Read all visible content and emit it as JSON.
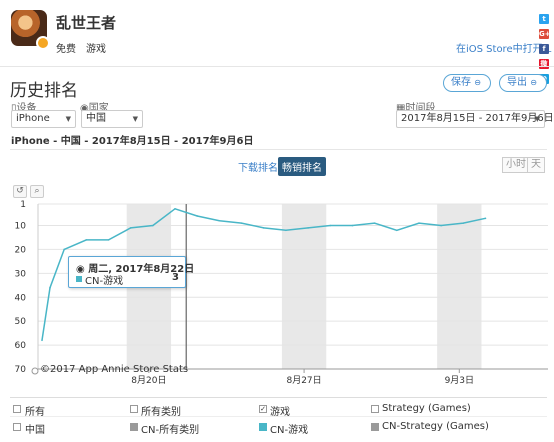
{
  "app": {
    "name": "乱世王者",
    "price": "免费",
    "category": "游戏",
    "store_link": "在iOS Store中打开 L"
  },
  "social": {
    "twitter": "t",
    "google": "G+",
    "facebook": "f",
    "weibo": "微",
    "qq": "Q"
  },
  "page": {
    "title": "历史排名",
    "save_label": "保存",
    "export_label": "导出",
    "lock_glyph": "🔒"
  },
  "filters": {
    "device_label": "设备",
    "device_value": "iPhone",
    "country_label": "国家",
    "country_value": "中国",
    "period_label": "时间段",
    "period_value": "2017年8月15日 - 2017年9月6日"
  },
  "summary": "iPhone - 中国 - 2017年8月15日 - 2017年9月6日",
  "chart_toggles": {
    "downloads": "下载排名",
    "revenue": "畅销排名",
    "hour": "小时",
    "day": "天"
  },
  "tools": {
    "reset": "↺",
    "zoom": "🔍"
  },
  "tooltip": {
    "date": "周二, 2017年8月22日",
    "series": "CN-游戏",
    "value": "3"
  },
  "copyright": "©2017 App Annie Store Stats",
  "chart_data": {
    "type": "line",
    "title": "",
    "xlabel": "",
    "ylabel": "",
    "y_reversed": true,
    "ylim": [
      1,
      70
    ],
    "yticks": [
      1,
      10,
      20,
      30,
      40,
      50,
      60,
      70
    ],
    "xlim": [
      "2017-08-15",
      "2017-09-07"
    ],
    "x_tick_labels": [
      {
        "date": "2017-08-20",
        "label": "8月20日"
      },
      {
        "date": "2017-08-27",
        "label": "8月27日"
      },
      {
        "date": "2017-09-03",
        "label": "9月3日"
      }
    ],
    "weekend_bands": [
      [
        "2017-08-19",
        "2017-08-21"
      ],
      [
        "2017-08-26",
        "2017-08-28"
      ],
      [
        "2017-09-02",
        "2017-09-04"
      ]
    ],
    "hover_date": "2017-08-22",
    "series": [
      {
        "name": "CN-游戏",
        "color": "#49b6c7",
        "points": [
          [
            "2017-08-15",
            58
          ],
          [
            "2017-08-15",
            36
          ],
          [
            "2017-08-16",
            20
          ],
          [
            "2017-08-17",
            16
          ],
          [
            "2017-08-18",
            16
          ],
          [
            "2017-08-19",
            11
          ],
          [
            "2017-08-20",
            10
          ],
          [
            "2017-08-21",
            3
          ],
          [
            "2017-08-22",
            6
          ],
          [
            "2017-08-23",
            8
          ],
          [
            "2017-08-24",
            9
          ],
          [
            "2017-08-25",
            11
          ],
          [
            "2017-08-26",
            12
          ],
          [
            "2017-08-27",
            11
          ],
          [
            "2017-08-28",
            10
          ],
          [
            "2017-08-29",
            10
          ],
          [
            "2017-08-30",
            9
          ],
          [
            "2017-08-31",
            12
          ],
          [
            "2017-09-01",
            9
          ],
          [
            "2017-09-02",
            10
          ],
          [
            "2017-09-03",
            9
          ],
          [
            "2017-09-04",
            7
          ]
        ]
      }
    ]
  },
  "legend": {
    "rows": [
      {
        "label": "所有",
        "cells": [
          {
            "label": "所有类别",
            "checked": false
          },
          {
            "label": "游戏",
            "checked": true
          },
          {
            "label": "Strategy (Games)",
            "checked": false
          }
        ]
      },
      {
        "label": "中国",
        "cells": [
          {
            "label": "CN-所有类别",
            "color": "#9a9a9a"
          },
          {
            "label": "CN-游戏",
            "color": "#49b6c7"
          },
          {
            "label": "CN-Strategy (Games)",
            "color": "#9a9a9a"
          }
        ]
      }
    ]
  }
}
